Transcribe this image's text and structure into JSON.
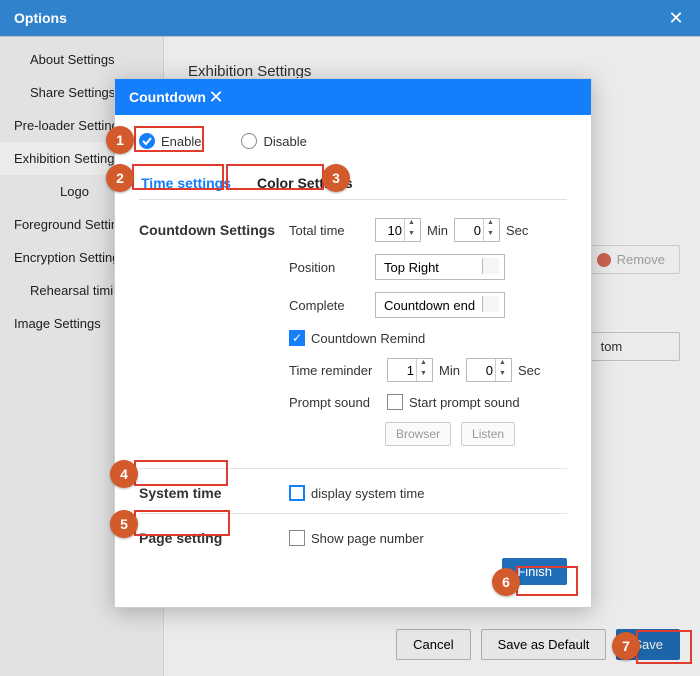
{
  "window": {
    "title": "Options"
  },
  "sidebar": {
    "items": [
      {
        "label": "About Settings",
        "level": 1
      },
      {
        "label": "Share Settings",
        "level": 1
      },
      {
        "label": "Pre-loader Settings",
        "level": 0
      },
      {
        "label": "Exhibition Settings",
        "level": 0,
        "active": true
      },
      {
        "label": "Logo",
        "level": 1
      },
      {
        "label": "Foreground Settings",
        "level": 0
      },
      {
        "label": "Encryption Settings",
        "level": 0
      },
      {
        "label": "Rehearsal timings",
        "level": 1
      },
      {
        "label": "Image Settings",
        "level": 0
      }
    ]
  },
  "content": {
    "heading": "Exhibition Settings",
    "remove_label": "Remove",
    "custom_label": "tom"
  },
  "footer": {
    "cancel": "Cancel",
    "save_default": "Save as Default",
    "save": "Save"
  },
  "dialog": {
    "title": "Countdown",
    "enable": "Enable",
    "disable": "Disable",
    "tab_time": "Time settings",
    "tab_color": "Color Settings",
    "section_countdown": "Countdown Settings",
    "total_time": "Total time",
    "min": "Min",
    "sec": "Sec",
    "total_min": "10",
    "total_sec": "0",
    "position": "Position",
    "position_value": "Top Right",
    "complete": "Complete",
    "complete_value": "Countdown end",
    "remind": "Countdown Remind",
    "time_reminder": "Time reminder",
    "remind_min": "1",
    "remind_sec": "0",
    "prompt_sound": "Prompt sound",
    "start_prompt": "Start prompt sound",
    "browser": "Browser",
    "listen": "Listen",
    "system_time": "System time",
    "display_system_time": "display system time",
    "page_setting": "Page setting",
    "show_page_number": "Show page number",
    "finish": "Finish"
  },
  "markers": [
    "1",
    "2",
    "3",
    "4",
    "5",
    "6",
    "7"
  ]
}
